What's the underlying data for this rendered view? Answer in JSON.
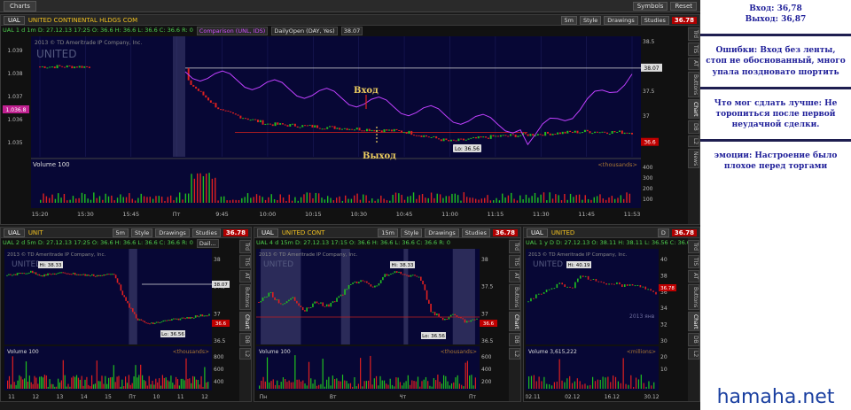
{
  "window": {
    "tab": "Charts",
    "actions": [
      "Symbols",
      "Reset"
    ]
  },
  "main": {
    "symbol": "UAL",
    "desc": "UNITED CONTINENTAL HLDGS COM",
    "price": "36.78",
    "buttons": [
      "5m",
      "Style",
      "Drawings",
      "Studies"
    ],
    "info": "UAL 1 d 1m  D: 27.12.13 17:25  O: 36.6  H: 36.6  L: 36.6  C: 36.6  R: 0",
    "study": "Comparison (UNL, IDS)",
    "study2": "DailyOpen (DAY, Yes)",
    "study3": "38.07",
    "copyright": "2013 © TD Ameritrade IP Company, Inc.",
    "brand": "UNITED",
    "price_ticks": [
      "38.5",
      "38",
      "37.5",
      "37",
      "36.5"
    ],
    "left_ticks": [
      "1.039",
      "1.038",
      "1.037",
      "1.036",
      "1.035"
    ],
    "price_label_right": "38.07",
    "price_label_left": "1.036.8",
    "last_price": "36.6",
    "low_label": "Lo: 36.56",
    "volume_label": "Volume",
    "volume_value": "100",
    "volume_units": "<thousands>",
    "vol_ticks": [
      "400",
      "300",
      "200",
      "100"
    ],
    "time_ticks": [
      "15:20",
      "15:30",
      "15:45",
      "Пт",
      "9:45",
      "10:00",
      "10:15",
      "10:30",
      "10:45",
      "11:00",
      "11:15",
      "11:30",
      "11:45",
      "11:53"
    ],
    "side_tabs": [
      "Trd",
      "TIS",
      "AT",
      "Buttons",
      "Chart",
      "DB",
      "L2",
      "News"
    ],
    "entry_label": "Вход",
    "exit_label": "Выход"
  },
  "panels": [
    {
      "symbol": "UAL",
      "desc": "UNIT",
      "price": "36.78",
      "interval": "5m",
      "info": "UAL 2 d 5m  D: 27.12.13 17:25  O: 36.6  H: 36.6  L: 36.6  C: 36.6  R: 0",
      "study": "Dail...",
      "copyright": "2013 © TD Ameritrade IP Company, Inc.",
      "hi": "Hi: 38.33",
      "lo": "Lo: 36.56",
      "ref": "38.07",
      "last": "36.6",
      "ticks": [
        "38",
        "37.5",
        "37",
        "36.5"
      ],
      "volume_value": "100",
      "vol_units": "<thousands>",
      "vol_ticks": [
        "800",
        "600",
        "400",
        "200"
      ],
      "time_ticks": [
        "11",
        "12",
        "13",
        "14",
        "15",
        "Пт",
        "10",
        "11",
        "12"
      ]
    },
    {
      "symbol": "UAL",
      "desc": "UNITED CONT",
      "price": "36.78",
      "interval": "15m",
      "info": "UAL 4 d 15m  D: 27.12.13 17:15  O: 36.6  H: 36.6  L: 36.6  C: 36.6  R: 0",
      "study": "",
      "copyright": "2013 © TD Ameritrade IP Company, Inc.",
      "hi": "Hi: 38.33",
      "lo": "Lo: 36.56",
      "ref": "",
      "last": "36.6",
      "ticks": [
        "38",
        "37.5",
        "37",
        "36.5"
      ],
      "volume_value": "100",
      "vol_units": "<thousands>",
      "vol_ticks": [
        "600",
        "400",
        "200"
      ],
      "time_ticks": [
        "Пн",
        "Вт",
        "Чт",
        "Пт"
      ]
    },
    {
      "symbol": "UAL",
      "desc": "UNITED",
      "price": "36.78",
      "interval": "D",
      "info": "UAL 1 y D  D: 27.12.13  O: 38.11  H: 38.11  L: 36.56  C: 36.6",
      "study": "",
      "copyright": "2013 © TD Ameritrade IP Company, Inc.",
      "hi": "Hi: 40.19",
      "lo": "",
      "ref": "",
      "last": "36.78",
      "ticks": [
        "40",
        "38",
        "36",
        "34",
        "32",
        "30"
      ],
      "volume_value": "3,615,222",
      "vol_units": "<millions>",
      "vol_ticks": [
        "20",
        "10"
      ],
      "time_ticks": [
        "02.11",
        "02.12",
        "16.12",
        "30.12"
      ],
      "year_mark": "2013 янв"
    }
  ],
  "notes": [
    "Вход: 36,78\nВыход: 36,87",
    "Ошибки: Вход без ленты, стоп не обоснованный, много упала поздновато шортить",
    "Что мог сдлать лучше: Не торопиться после первой неудачной сделки.",
    "эмоции: Настроение было плохое перед торгами"
  ],
  "watermark": "hamaha.net",
  "colors": {
    "bull": "#20c020",
    "bear": "#e02020",
    "comparison": "#c040ff",
    "chart_bg": "#070735",
    "note_text": "#1f1f99"
  },
  "chart_data": {
    "type": "line",
    "title": "UAL 1 d 1m",
    "x": [
      "15:20",
      "15:30",
      "15:45",
      "Пт",
      "9:45",
      "10:00",
      "10:15",
      "10:30",
      "10:45",
      "11:00",
      "11:15",
      "11:30",
      "11:45",
      "11:53"
    ],
    "series": [
      {
        "name": "UAL",
        "values": [
          38.1,
          38.1,
          38.05,
          38.0,
          37.2,
          36.95,
          36.9,
          36.85,
          36.8,
          36.6,
          36.7,
          36.75,
          36.8,
          36.78
        ]
      }
    ],
    "annotations": [
      {
        "label": "Вход",
        "x": "10:30",
        "y": 36.78
      },
      {
        "label": "Выход",
        "x": "10:30",
        "y": 36.87
      },
      {
        "label": "Lo: 36.56",
        "x": "11:00",
        "y": 36.56
      }
    ],
    "ylim": [
      36.4,
      38.6
    ]
  }
}
